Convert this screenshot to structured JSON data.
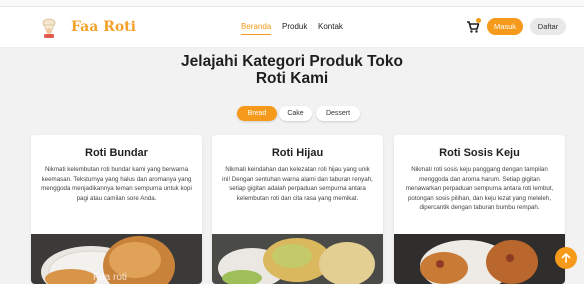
{
  "brand": {
    "name": "Faa Roti",
    "accent": "#f59a1b"
  },
  "nav": {
    "links": [
      {
        "label": "Beranda",
        "active": true
      },
      {
        "label": "Produk",
        "active": false
      },
      {
        "label": "Kontak",
        "active": false
      }
    ],
    "cart_icon": "cart-icon",
    "login_label": "Masuk",
    "register_label": "Daftar"
  },
  "hero": {
    "title_line1": "Jelajahi Kategori Produk Toko",
    "title_line2": "Roti Kami"
  },
  "filters": [
    {
      "label": "Bread",
      "active": true
    },
    {
      "label": "Cake",
      "active": false
    },
    {
      "label": "Dessert",
      "active": false
    }
  ],
  "products": [
    {
      "name": "Roti Bundar",
      "description": "Nikmati kelembutan roti bundar kami yang berwarna keemasan. Teksturnya yang halus dan aromanya yang menggoda menjadikannya teman sempurna untuk kopi pagi atau camilan sore Anda."
    },
    {
      "name": "Roti Hijau",
      "description": "Nikmati keindahan dan kelezatan roti hijau yang unik ini! Dengan sentuhan warna alami dan taburan renyah, setiap gigitan adalah perpaduan sempurna antara kelembutan roti dan cita rasa yang memikat."
    },
    {
      "name": "Roti Sosis Keju",
      "description": "Nikmati roti sosis keju panggang dengan tampilan menggoda dan aroma harum. Setiap gigitan menawarkan perpaduan sempurna antara roti lembut, potongan sosis pilihan, dan keju lezat yang meleleh, dipercantik dengan taburan bumbu rempah."
    }
  ],
  "scroll_top_icon": "arrow-up-icon",
  "photo_watermark": "Faa roti"
}
